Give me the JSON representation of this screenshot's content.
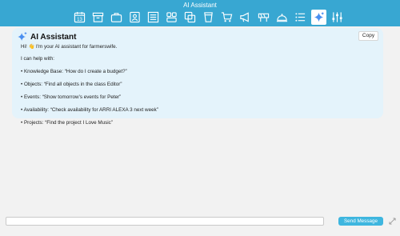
{
  "window": {
    "title": "AI Assistant"
  },
  "toolbar": {
    "buttons": [
      {
        "icon": "calendar-icon",
        "label": "13"
      },
      {
        "icon": "archive-box-icon"
      },
      {
        "icon": "briefcase-icon"
      },
      {
        "icon": "contact-card-icon"
      },
      {
        "icon": "list-document-icon"
      },
      {
        "icon": "blocks-icon"
      },
      {
        "icon": "copy-icon"
      },
      {
        "icon": "cup-icon"
      },
      {
        "icon": "cart-icon"
      },
      {
        "icon": "megaphone-icon"
      },
      {
        "icon": "barrier-icon"
      },
      {
        "icon": "bell-icon"
      },
      {
        "icon": "bullet-list-icon"
      },
      {
        "icon": "sparkle-icon",
        "active": true
      },
      {
        "icon": "sliders-icon"
      }
    ]
  },
  "chat": {
    "assistant_name": "AI Assistant",
    "copy_label": "Copy",
    "lines": [
      "Hi! 👋 I'm your AI assistant for farmerswife.",
      "I can help with:",
      "• Knowledge Base: “How do I create a budget?”",
      "• Objects: “Find all objects in the class Editor”",
      "• Events: “Show tomorrow’s events for Peter”",
      "• Availability: “Check availability for ARRI ALEXA 3 next week”",
      "• Projects: “Find the project I Love Music”"
    ]
  },
  "composer": {
    "input_value": "",
    "send_label": "Send Message"
  },
  "colors": {
    "titlebar": "#38a7d2",
    "card_bg": "#e4f3fb",
    "accent": "#3eb6df",
    "sparkle": "#4a8ff0"
  }
}
